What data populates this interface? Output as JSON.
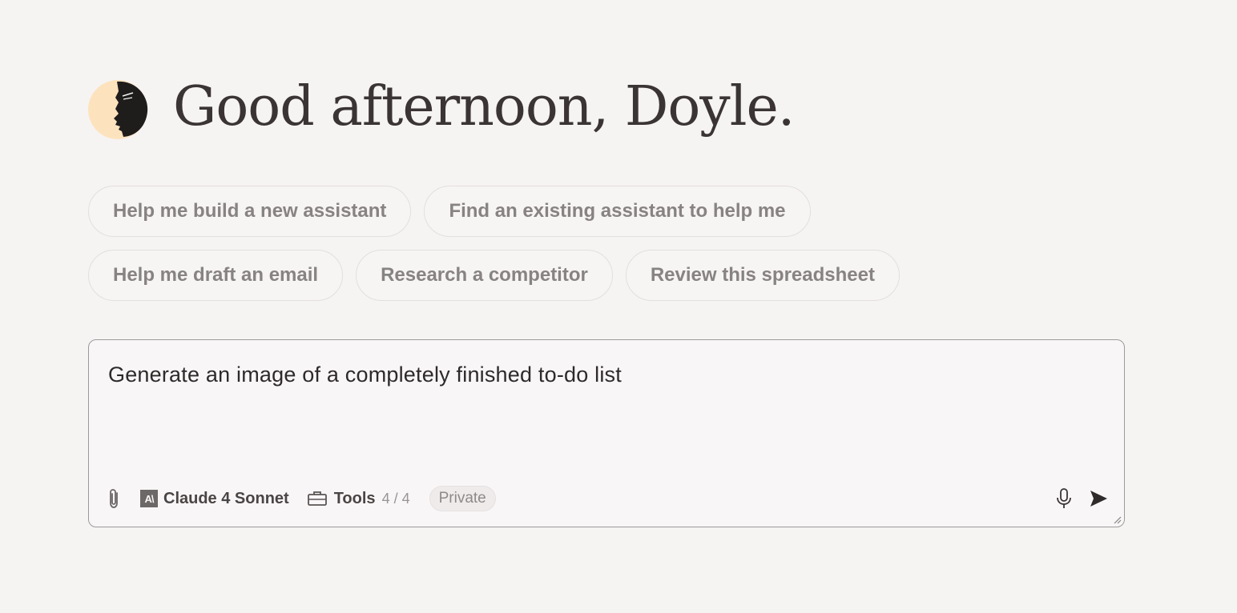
{
  "greeting": {
    "text": "Good afternoon, Doyle.",
    "avatar_icon": "face-profile-avatar"
  },
  "suggestions": {
    "row1": [
      "Help me build a new assistant",
      "Find an existing assistant to help me"
    ],
    "row2": [
      "Help me draft an email",
      "Research a competitor",
      "Review this spreadsheet"
    ]
  },
  "composer": {
    "prompt_text": "Generate an image of a completely finished to-do list",
    "attach_icon": "paperclip-icon",
    "model": {
      "icon": "anthropic-logo-icon",
      "icon_text": "A\\",
      "label": "Claude 4 Sonnet"
    },
    "tools": {
      "icon": "briefcase-icon",
      "label": "Tools",
      "count": "4 / 4"
    },
    "privacy_badge": "Private",
    "mic_icon": "microphone-icon",
    "send_icon": "send-icon"
  },
  "colors": {
    "background": "#f6f3f3",
    "avatar_fill": "#fde3bd",
    "text_dark": "#3a3534",
    "chip_text": "#888383"
  }
}
